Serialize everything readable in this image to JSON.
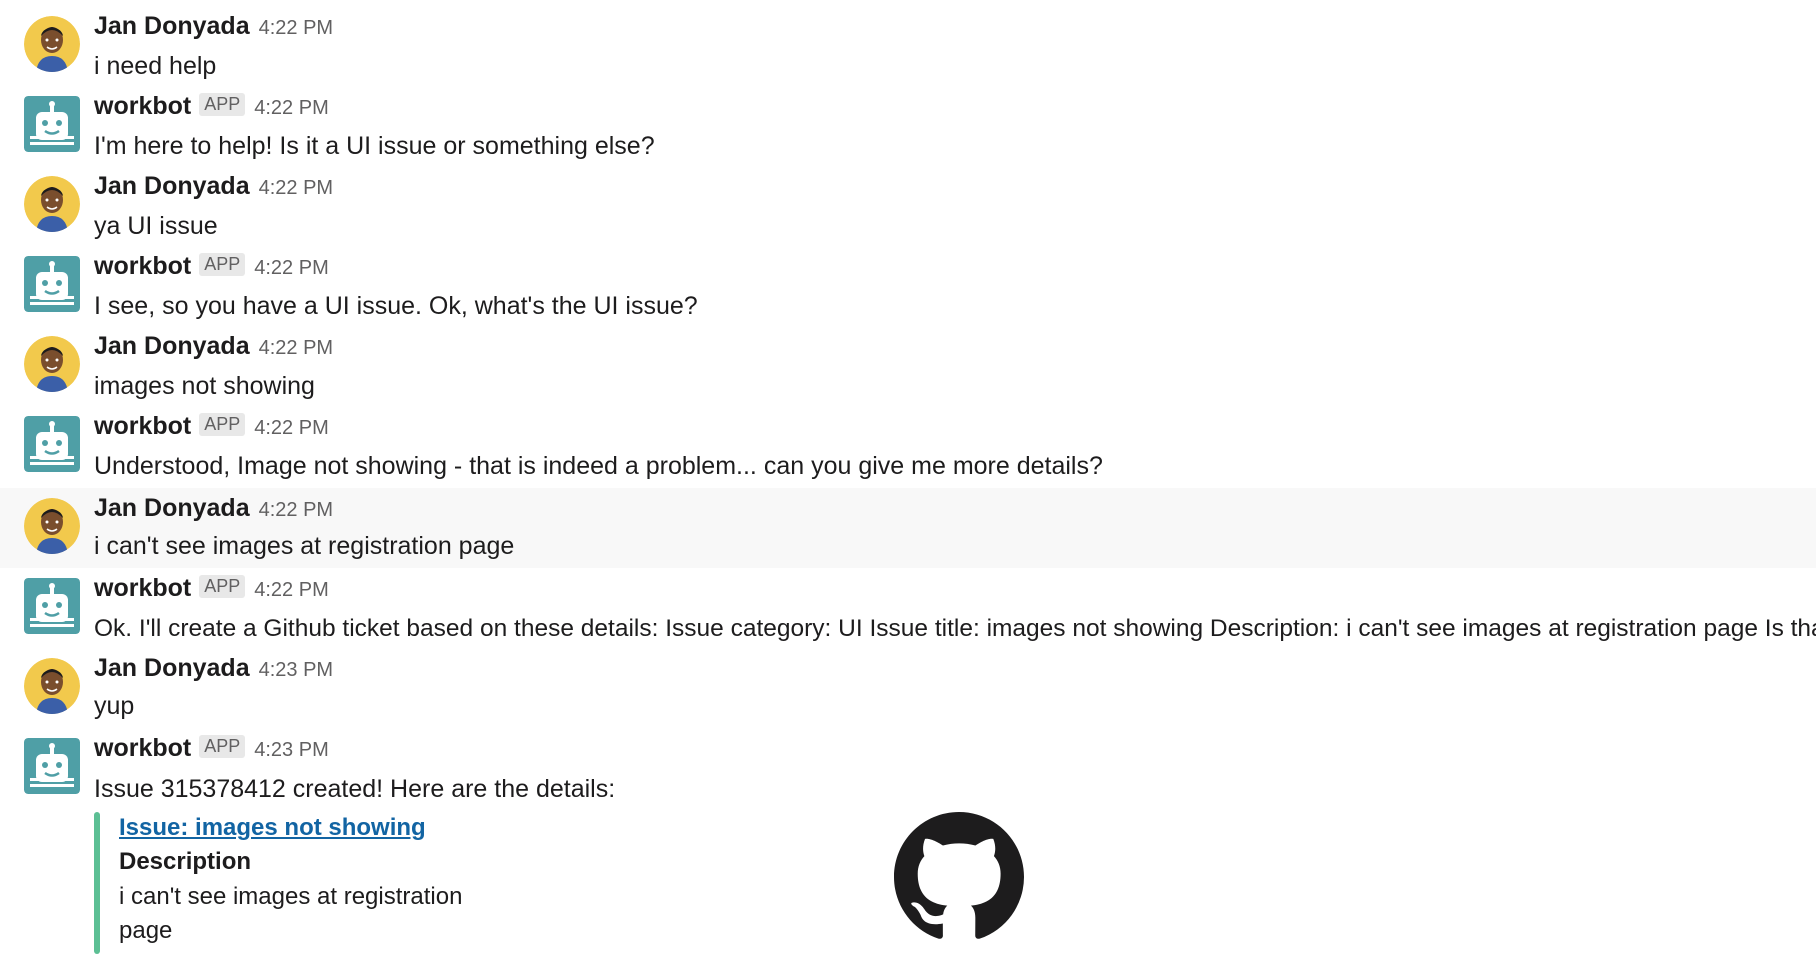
{
  "app": {
    "bot_badge": "APP",
    "accent_color": "#5cbf94",
    "link_color": "#1264a3",
    "bot_avatar_color": "#4f9fa6",
    "user_avatar_bg": "#f2c94c"
  },
  "messages": [
    {
      "author": "Jan Donyada",
      "is_bot": false,
      "time": "4:22 PM",
      "text": "i need help"
    },
    {
      "author": "workbot",
      "is_bot": true,
      "time": "4:22 PM",
      "text": "I'm here to help! Is it a UI issue or something else?"
    },
    {
      "author": "Jan Donyada",
      "is_bot": false,
      "time": "4:22 PM",
      "text": "ya UI issue"
    },
    {
      "author": "workbot",
      "is_bot": true,
      "time": "4:22 PM",
      "text": "I see, so you have a UI issue. Ok, what's the UI issue?"
    },
    {
      "author": "Jan Donyada",
      "is_bot": false,
      "time": "4:22 PM",
      "text": "images not showing"
    },
    {
      "author": "workbot",
      "is_bot": true,
      "time": "4:22 PM",
      "text": "Understood, Image not showing - that is indeed a problem... can you give me more details?"
    },
    {
      "author": "Jan Donyada",
      "is_bot": false,
      "time": "4:22 PM",
      "text": "i can't see images at registration page",
      "highlighted": true
    },
    {
      "author": "workbot",
      "is_bot": true,
      "time": "4:22 PM",
      "text": "Ok. I'll create a Github ticket based on these details: Issue category: UI Issue title: images not showing Description: i can't see images at registration page Is that ok?"
    },
    {
      "author": "Jan Donyada",
      "is_bot": false,
      "time": "4:23 PM",
      "text": "yup"
    },
    {
      "author": "workbot",
      "is_bot": true,
      "time": "4:23 PM",
      "text": "Issue 315378412 created! Here are the details:"
    }
  ],
  "attachment": {
    "title": "Issue:  images not showing",
    "field_title": "Description",
    "field_value": "i can't see images at registration page",
    "logo_icon": "github-icon"
  }
}
